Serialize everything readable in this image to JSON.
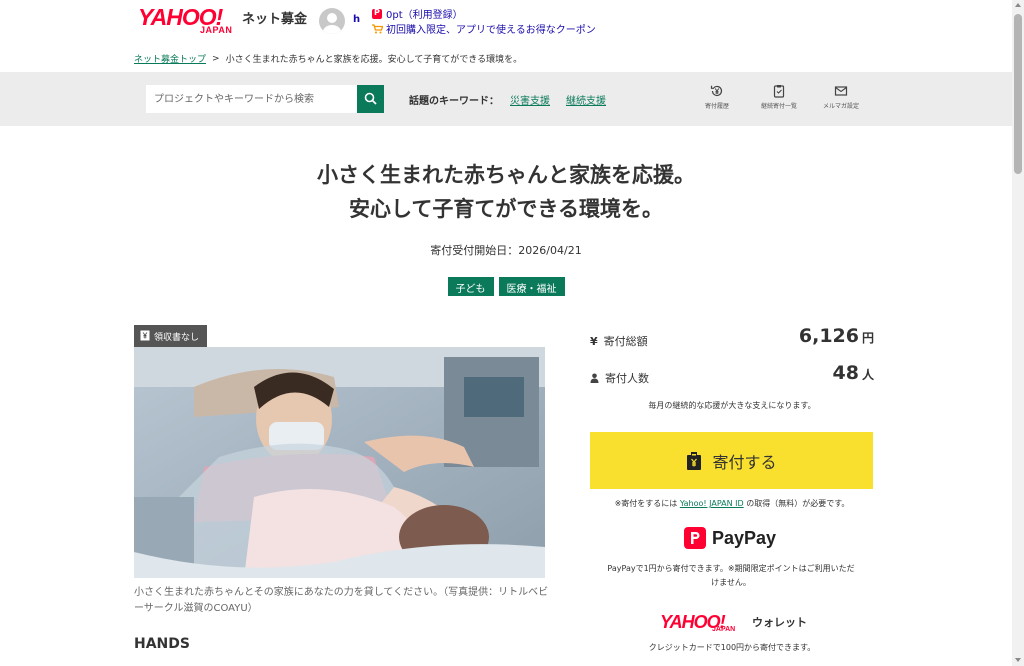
{
  "header": {
    "logo_text": "YAHOO!",
    "logo_sub": "JAPAN",
    "service_name": "ネット募金",
    "username": "h",
    "points_text": "0pt（利用登録）",
    "coupon_text": "初回購入限定、アプリで使えるお得なクーポン"
  },
  "breadcrumb": {
    "home": "ネット募金トップ",
    "separator": ">",
    "current": "小さく生まれた赤ちゃんと家族を応援。安心して子育てができる環境を。"
  },
  "search": {
    "placeholder": "プロジェクトやキーワードから検索"
  },
  "keywords": {
    "label": "話題のキーワード：",
    "items": [
      "災害支援",
      "継続支援"
    ]
  },
  "utilities": [
    {
      "label": "寄付履歴",
      "icon": "yen-history-icon"
    },
    {
      "label": "継続寄付一覧",
      "icon": "clipboard-icon"
    },
    {
      "label": "メルマガ設定",
      "icon": "mail-icon"
    }
  ],
  "project": {
    "title_line1": "小さく生まれた赤ちゃんと家族を応援。",
    "title_line2": "安心して子育てができる環境を。",
    "start_date": "寄付受付開始日：2026/04/21",
    "tags": [
      "子ども",
      "医療・福祉"
    ],
    "photo_badge": "領収書なし",
    "caption": "小さく生まれた赤ちゃんとその家族にあなたの力を貸してください。（写真提供：リトルベビーサークル滋賀のCOAYU）",
    "section_heading": "HANDS"
  },
  "stats": {
    "total_label": "寄付総額",
    "total_value": "6,126",
    "total_unit": "円",
    "people_label": "寄付人数",
    "people_value": "48",
    "people_unit": "人",
    "encourage": "毎月の継続的な応援が大きな支えになります。"
  },
  "donate": {
    "button_label": "寄付する",
    "notice_prefix": "※寄付をするには",
    "notice_link": "Yahoo! JAPAN ID",
    "notice_suffix": "の取得（無料）が必要です。"
  },
  "paypay": {
    "logo_text": "PayPay",
    "note": "PayPayで1円から寄付できます。※期間限定ポイントはご利用いただけません。"
  },
  "wallet": {
    "logo_text": "YAHOO!",
    "logo_sub": "JAPAN",
    "wallet_label": "ウォレット",
    "note": "クレジットカードで100円から寄付できます。"
  },
  "colors": {
    "brand_green": "#0b7a5a",
    "yahoo_red": "#ff0033",
    "donate_yellow": "#f9e02f"
  }
}
